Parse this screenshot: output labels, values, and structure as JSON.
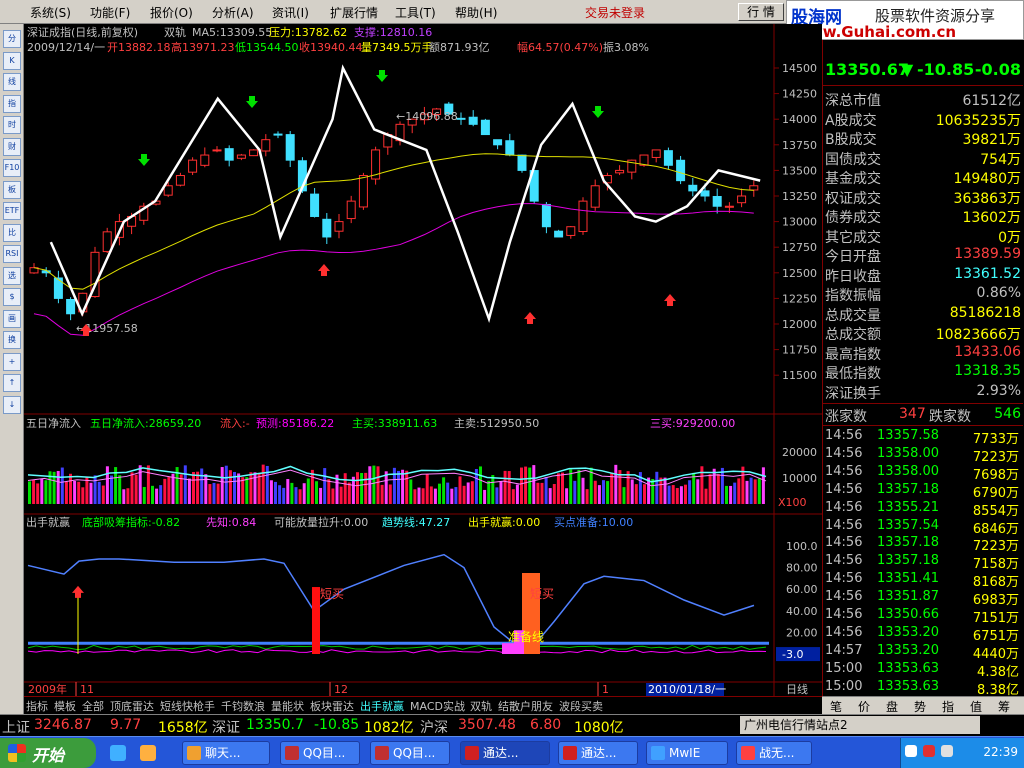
{
  "menu": [
    {
      "label": "系统(S)"
    },
    {
      "label": "功能(F)"
    },
    {
      "label": "报价(O)"
    },
    {
      "label": "分析(A)"
    },
    {
      "label": "资讯(I)"
    },
    {
      "label": "扩展行情"
    },
    {
      "label": "工具(T)"
    },
    {
      "label": "帮助(H)"
    }
  ],
  "login_status": "交易未登录",
  "window_buttons": {
    "quote": "行 情",
    "trade": "交 易"
  },
  "banner": {
    "logo": "股海网",
    "slogan": "股票软件资源分享",
    "url": "www.Guhai.com.cn"
  },
  "left_toolbar": [
    "分",
    "K",
    "线",
    "指",
    "时",
    "财",
    "F10",
    "板",
    "ETF",
    "比",
    "RSI",
    "选",
    "$",
    "画",
    "换",
    "+",
    "↑",
    "↓"
  ],
  "main_chart": {
    "header": {
      "name": "深证成指(日线,前复权)",
      "ma_label": "双轨",
      "ma5": "MA5:13309.55",
      "pressure": "压力:13782.62",
      "support": "支撑:12810.16"
    },
    "ohlc": {
      "date": "2009/12/14/一",
      "open": "开13882.18",
      "high": "高13971.23",
      "low": "低13544.50",
      "close": "收13940.44",
      "volume": "量7349.5万手",
      "amount": "额871.93亿",
      "change": "幅64.57(0.47%)",
      "amplitude": "振3.08%"
    },
    "annotations": {
      "low_label": "←11957.58",
      "high_label": "←14096.88"
    },
    "y_ticks": [
      "14500",
      "14250",
      "14000",
      "13750",
      "13500",
      "13250",
      "13000",
      "12750",
      "12500",
      "12250",
      "12000",
      "11750",
      "11500"
    ]
  },
  "mid_chart": {
    "header": {
      "title": "五日净流入",
      "v1": "五日净流入:28659.20",
      "v2": "流入:-",
      "v3": "预测:85186.22",
      "v4": "主买:338911.63",
      "v5": "主卖:512950.50",
      "v6": "三买:929200.00"
    },
    "y_ticks": [
      "20000",
      "10000"
    ],
    "unit": "X100"
  },
  "low_chart": {
    "header": {
      "title": "出手就赢",
      "v1": "底部吸筹指标:-0.82",
      "v2": "先知:0.84",
      "v3": "可能放量拉升:0.00",
      "v4": "趋势线:47.27",
      "v5": "出手就赢:0.00",
      "v6": "买点准备:10.00"
    },
    "y_ticks": [
      "100.0",
      "80.00",
      "60.00",
      "40.00",
      "20.00",
      "0.0"
    ],
    "current_value": "-3.0",
    "labels": {
      "short_buy_1": "短买",
      "short_buy_2": "短买",
      "pre_line": "准备线"
    }
  },
  "x_axis": {
    "labels": [
      "2009年",
      "11",
      "12",
      "1"
    ],
    "date_box": "2010/01/18/一",
    "period": "日线"
  },
  "bottom_tabs": [
    "指标",
    "模板",
    "全部",
    "顶底雷达",
    "短线快枪手",
    "千钧数浪",
    "量能状",
    "板块雷达",
    "出手就赢",
    "MACD实战",
    "双轨",
    "结散户朋友",
    "波段买卖"
  ],
  "quote": {
    "price": "13350.67",
    "arrow": "▼",
    "change": "-10.85",
    "change_pct": "-0.08"
  },
  "stats": [
    {
      "label": "深总市值",
      "value": "61512亿",
      "color": "#c0c0c0"
    },
    {
      "label": "A股成交",
      "value": "10635235万",
      "color": "#ffff00"
    },
    {
      "label": "B股成交",
      "value": "39821万",
      "color": "#ffff00"
    },
    {
      "label": "国债成交",
      "value": "754万",
      "color": "#ffff00"
    },
    {
      "label": "基金成交",
      "value": "149480万",
      "color": "#ffff00"
    },
    {
      "label": "权证成交",
      "value": "363863万",
      "color": "#ffff00"
    },
    {
      "label": "债券成交",
      "value": "13602万",
      "color": "#ffff00"
    },
    {
      "label": "其它成交",
      "value": "0万",
      "color": "#ffff00"
    },
    {
      "label": "今日开盘",
      "value": "13389.59",
      "color": "#ff4040"
    },
    {
      "label": "昨日收盘",
      "value": "13361.52",
      "color": "#40ffff"
    },
    {
      "label": "指数振幅",
      "value": "0.86%",
      "color": "#c0c0c0"
    },
    {
      "label": "总成交量",
      "value": "85186218",
      "color": "#ffff00"
    },
    {
      "label": "总成交额",
      "value": "10823666万",
      "color": "#ffff00"
    },
    {
      "label": "最高指数",
      "value": "13433.06",
      "color": "#ff4040"
    },
    {
      "label": "最低指数",
      "value": "13318.35",
      "color": "#00ff00"
    },
    {
      "label": "深证换手",
      "value": "2.93%",
      "color": "#c0c0c0"
    }
  ],
  "updown": {
    "up_label": "涨家数",
    "up": "347",
    "down_label": "跌家数",
    "down": "546"
  },
  "ticks": [
    {
      "t": "14:56",
      "p": "13357.58",
      "v": "7733万"
    },
    {
      "t": "14:56",
      "p": "13358.00",
      "v": "7223万"
    },
    {
      "t": "14:56",
      "p": "13358.00",
      "v": "7698万"
    },
    {
      "t": "14:56",
      "p": "13357.18",
      "v": "6790万"
    },
    {
      "t": "14:56",
      "p": "13355.21",
      "v": "8554万"
    },
    {
      "t": "14:56",
      "p": "13357.54",
      "v": "6846万"
    },
    {
      "t": "14:56",
      "p": "13357.18",
      "v": "7223万"
    },
    {
      "t": "14:56",
      "p": "13357.18",
      "v": "7158万"
    },
    {
      "t": "14:56",
      "p": "13351.41",
      "v": "8168万"
    },
    {
      "t": "14:56",
      "p": "13351.87",
      "v": "6983万"
    },
    {
      "t": "14:56",
      "p": "13350.66",
      "v": "7151万"
    },
    {
      "t": "14:56",
      "p": "13353.20",
      "v": "6751万"
    },
    {
      "t": "14:57",
      "p": "13353.20",
      "v": "4440万"
    },
    {
      "t": "15:00",
      "p": "13353.63",
      "v": "4.38亿"
    },
    {
      "t": "15:00",
      "p": "13353.63",
      "v": "8.38亿"
    }
  ],
  "right_tabs": [
    "笔",
    "价",
    "盘",
    "势",
    "指",
    "值",
    "筹"
  ],
  "ticker": {
    "sh_label": "上证",
    "sh_price": "3246.87",
    "sh_chg": "9.77",
    "sh_amt": "1658亿",
    "sz_label": "深证",
    "sz_price": "13350.7",
    "sz_chg": "-10.85",
    "sz_amt": "1082亿",
    "hs_label": "沪深",
    "hs_price": "3507.48",
    "hs_chg": "6.80",
    "hs_amt": "1080亿"
  },
  "station": "广州电信行情站点2",
  "taskbar": {
    "start": "开始",
    "tasks": [
      "聊天...",
      "QQ目...",
      "QQ目...",
      "通达...",
      "通达...",
      "MwIE",
      "战无..."
    ],
    "clock": "22:39"
  }
}
